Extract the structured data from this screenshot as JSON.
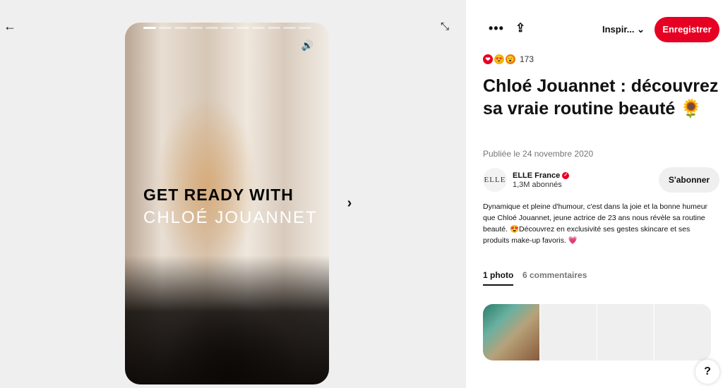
{
  "nav": {
    "back_icon": "←",
    "expand_icon": "⤡",
    "next_icon": "›"
  },
  "story": {
    "progress_segments": 11,
    "active_segment": 1,
    "volume_icon": "🔊",
    "title_line1": "GET READY WITH",
    "title_line2": "CHLOÉ JOUANNET"
  },
  "toolbar": {
    "more_icon": "•••",
    "share_icon": "⇪",
    "board_label": "Inspir...",
    "board_chevron": "⌄",
    "save_label": "Enregistrer"
  },
  "reactions": {
    "icons": [
      "❤",
      "😍",
      "😮"
    ],
    "count": "173"
  },
  "pin": {
    "title": "Chloé Jouannet : découvrez sa vraie routine beauté 🌻",
    "date": "Publiée le 24 novembre 2020",
    "description": "Dynamique et pleine d'humour, c'est dans la joie et la bonne humeur que Chloé Jouannet, jeune actrice de 23 ans nous révèle sa routine beauté. 😍Découvrez en exclusivité ses gestes skincare et ses produits make-up favoris. 💗"
  },
  "profile": {
    "avatar_text": "ELLE",
    "name": "ELLE France",
    "verified_icon": "✓",
    "followers": "1,3M abonnés",
    "follow_label": "S'abonner"
  },
  "tabs": {
    "photo_label": "1 photo",
    "comments_label": "6 commentaires"
  },
  "help": {
    "label": "?"
  },
  "colors": {
    "accent": "#e60023",
    "panel_bg": "#efefef"
  }
}
